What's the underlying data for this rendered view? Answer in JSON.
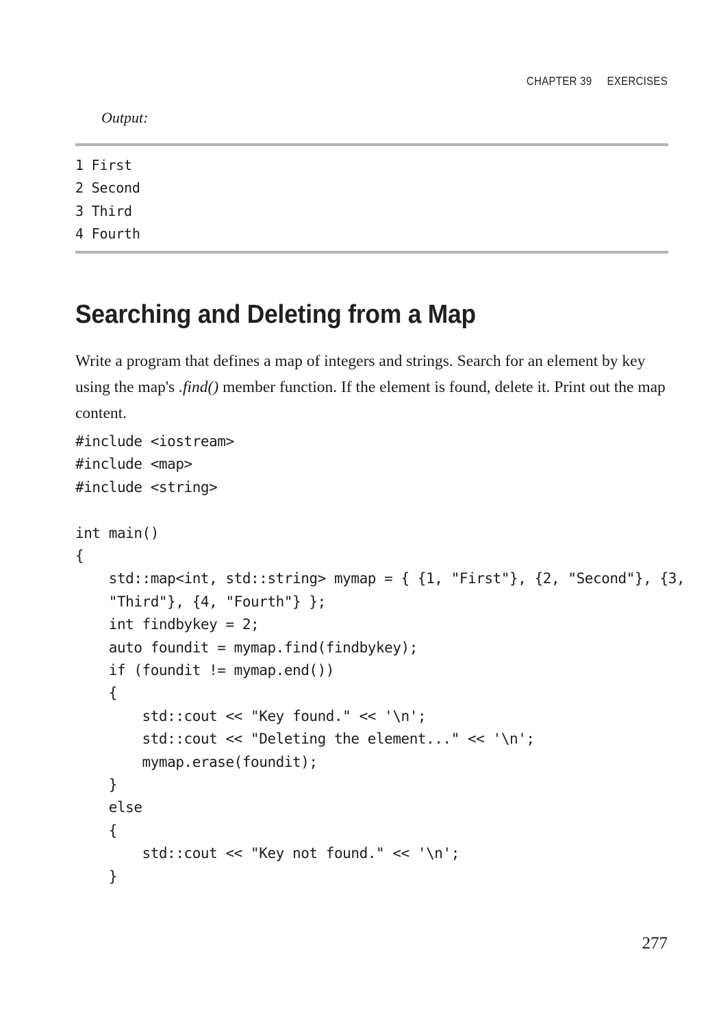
{
  "running_head": {
    "chapter": "CHAPTER 39",
    "section": "EXERCISES",
    "full": "CHAPTER 39     EXERCISES"
  },
  "output_section": {
    "label": "Output:",
    "lines": [
      "1 First",
      "2 Second",
      "3 Third",
      "4 Fourth"
    ]
  },
  "heading": "Searching and Deleting from a Map",
  "paragraph": {
    "part1": "Write a program that defines a map of integers and strings. Search for an element by key using the map's ",
    "emphasis": ".find()",
    "part2": " member function. If the element is found, delete it. Print out the map content."
  },
  "code": {
    "lines": [
      "#include <iostream>",
      "#include <map>",
      "#include <string>",
      "",
      "int main()",
      "{",
      "    std::map<int, std::string> mymap = { {1, \"First\"}, {2, \"Second\"}, {3,",
      "    \"Third\"}, {4, \"Fourth\"} };",
      "    int findbykey = 2;",
      "    auto foundit = mymap.find(findbykey);",
      "    if (foundit != mymap.end())",
      "    {",
      "        std::cout << \"Key found.\" << '\\n';",
      "        std::cout << \"Deleting the element...\" << '\\n';",
      "        mymap.erase(foundit);",
      "    }",
      "    else",
      "    {",
      "        std::cout << \"Key not found.\" << '\\n';",
      "    }"
    ]
  },
  "page_number": "277",
  "colors": {
    "rule": "#b3b3b3",
    "text": "#1a1a1a",
    "code_text": "#1c1c1c"
  }
}
